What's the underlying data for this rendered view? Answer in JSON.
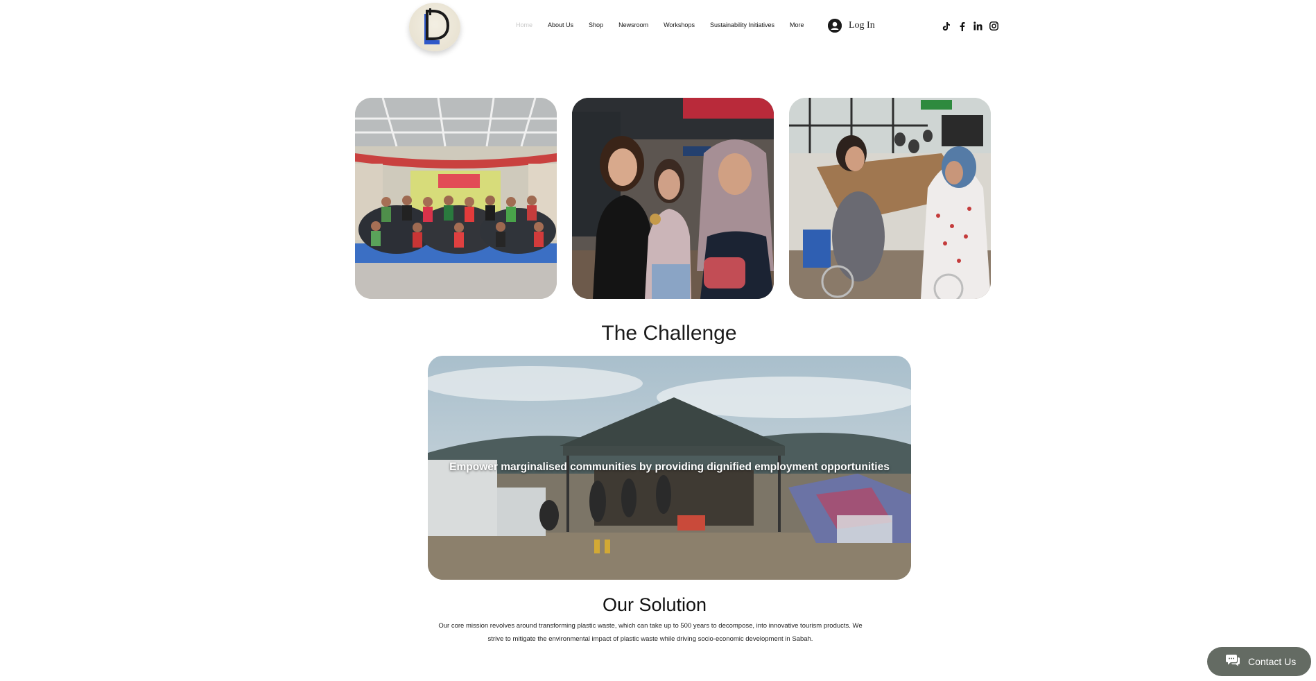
{
  "header": {
    "nav": [
      {
        "label": "Home",
        "active": true
      },
      {
        "label": "About Us"
      },
      {
        "label": "Shop"
      },
      {
        "label": "Newsroom"
      },
      {
        "label": "Workshops"
      },
      {
        "label": "Sustainability Initiatives"
      },
      {
        "label": "More"
      }
    ],
    "login_label": "Log In",
    "social_icons": [
      "tiktok-icon",
      "facebook-icon",
      "linkedin-icon",
      "instagram-icon"
    ]
  },
  "colors": {
    "contact_button": "#646b63",
    "nav_active": "#c9c9c9",
    "logo_blue": "#2f58c9"
  },
  "challenge": {
    "title": "The Challenge",
    "caption": "Empower marginalised communities by providing dignified employment opportunities"
  },
  "solution": {
    "title": "Our Solution",
    "text_line1": "Our core mission revolves around transforming plastic waste, which can take up to 500 years to decompose, into innovative tourism products. We",
    "text_line2": "strive to mitigate the environmental impact of plastic waste while driving socio-economic development in Sabah."
  },
  "contact": {
    "label": "Contact Us"
  }
}
